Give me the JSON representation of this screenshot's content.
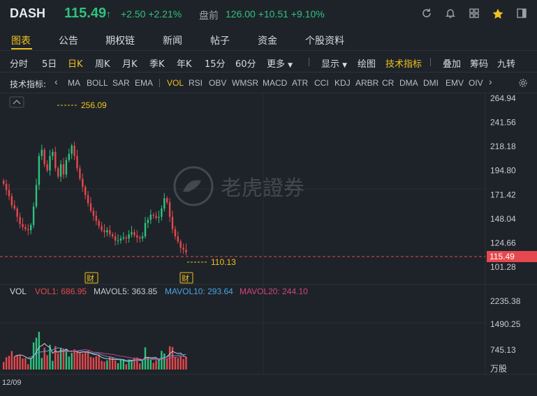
{
  "header": {
    "symbol": "DASH",
    "price": "115.49",
    "arrow": "↑",
    "change": "+2.50 +2.21%",
    "premarket_label": "盘前",
    "premarket": "126.00 +10.51 +9.10%",
    "icons": [
      "refresh-icon",
      "bell-icon",
      "grid-icon",
      "star-icon",
      "panel-icon"
    ],
    "star_color": "#f0c21d"
  },
  "tabs": [
    "图表",
    "公告",
    "期权链",
    "新闻",
    "帖子",
    "资金",
    "个股资料"
  ],
  "active_tab": "图表",
  "periods": [
    "分时",
    "5日",
    "日K",
    "周K",
    "月K",
    "季K",
    "年K",
    "15分",
    "60分",
    "更多"
  ],
  "active_period": "日K",
  "period_tools": [
    "显示",
    "绘图",
    "技术指标",
    "叠加",
    "筹码",
    "九转"
  ],
  "indicator_label": "技术指标:",
  "indicators": [
    "MA",
    "BOLL",
    "SAR",
    "EMA",
    "VOL",
    "RSI",
    "OBV",
    "WMSR",
    "MACD",
    "ATR",
    "CCI",
    "KDJ",
    "ARBR",
    "CR",
    "DMA",
    "DMI",
    "EMV",
    "OIV"
  ],
  "active_indicator": "VOL",
  "watermark": "老虎證券",
  "chart_data": {
    "type": "candlestick",
    "y_axis_labels": [
      "264.94",
      "241.56",
      "218.18",
      "194.80",
      "171.42",
      "148.04",
      "124.66",
      "101.28"
    ],
    "ylim": [
      101.28,
      264.94
    ],
    "current_price": "115.49",
    "high_marker": "256.09",
    "low_marker": "110.13",
    "earnings_marker": "财",
    "date_label": "12/09",
    "volume": {
      "label": "VOL",
      "vol1": "VOL1: 686.95",
      "mavol5": "MAVOL5: 363.85",
      "mavol10": "MAVOL10: 293.64",
      "mavol20": "MAVOL20: 244.10",
      "axis_labels": [
        "2235.38",
        "1490.25",
        "745.13"
      ],
      "unit": "万股"
    },
    "colors": {
      "up": "#2ec27e",
      "down": "#e5484d",
      "price_line": "#e5484d",
      "marker": "#f0c21d",
      "mavol5": "#c9ccd1",
      "mavol10": "#4aa3df",
      "mavol20": "#d0457e"
    },
    "closes": [
      182,
      176,
      170,
      161,
      158,
      150,
      143,
      140,
      138,
      137,
      142,
      160,
      181,
      209,
      215,
      201,
      195,
      209,
      213,
      197,
      189,
      201,
      191,
      205,
      211,
      219,
      209,
      197,
      187,
      179,
      171,
      163,
      156,
      151,
      146,
      141,
      137,
      135,
      137,
      133,
      131,
      127,
      127,
      129,
      130,
      129,
      133,
      135,
      132,
      130,
      129,
      131,
      144,
      147,
      152,
      151,
      149,
      150,
      158,
      168,
      164,
      150,
      138,
      131,
      126,
      120,
      118,
      115.49
    ]
  }
}
